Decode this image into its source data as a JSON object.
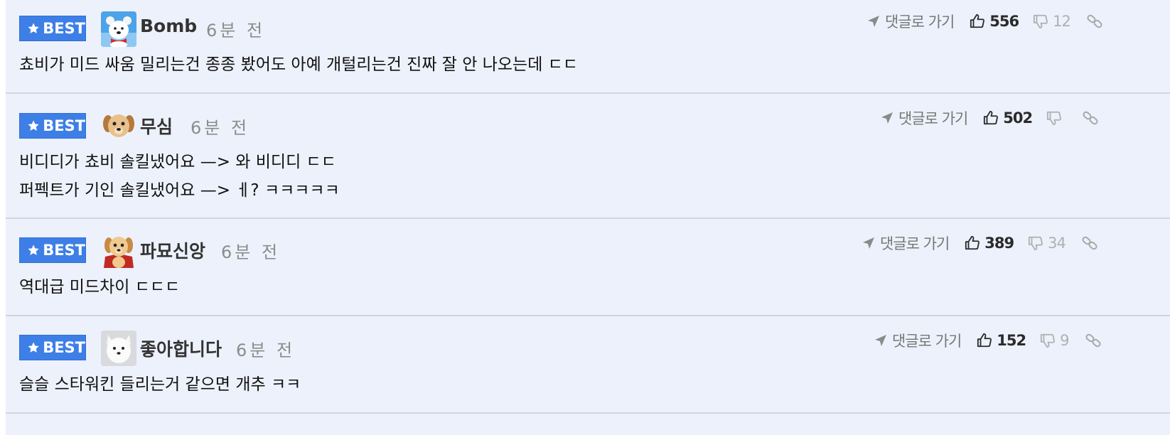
{
  "ui": {
    "best_label": "BEST",
    "goto_label": "댓글로 가기"
  },
  "comments": [
    {
      "nickname": "Bomb",
      "time": "6분 전",
      "lines": [
        "쵸비가 미드 싸움 밀리는건 종종 봤어도 아예 개털리는건 진짜 잘 안 나오는데 ㄷㄷ"
      ],
      "likes": "556",
      "dislikes": "12",
      "avatar": "polar-bear-icon"
    },
    {
      "nickname": "무심",
      "time": "6분 전",
      "lines": [
        "비디디가 쵸비 솔킬냈어요 —> 와 비디디 ㄷㄷ",
        "퍼펙트가 기인 솔킬냈어요 —> ㅔ? ㅋㅋㅋㅋㅋ"
      ],
      "likes": "502",
      "dislikes": "",
      "avatar": "puppy-icon"
    },
    {
      "nickname": "파묘신앙",
      "time": "6분 전",
      "lines": [
        "역대급 미드차이 ㄷㄷㄷ"
      ],
      "likes": "389",
      "dislikes": "34",
      "avatar": "puppy-cape-icon"
    },
    {
      "nickname": "좋아합니다",
      "time": "6분 전",
      "lines": [
        "슬슬 스타워킨 들리는거 같으면 개추 ㅋㅋ"
      ],
      "likes": "152",
      "dislikes": "9",
      "avatar": "white-dog-icon"
    }
  ],
  "colors": {
    "background": "#edf1fb",
    "best_badge": "#3d7fe6",
    "divider": "#d3d5da"
  }
}
